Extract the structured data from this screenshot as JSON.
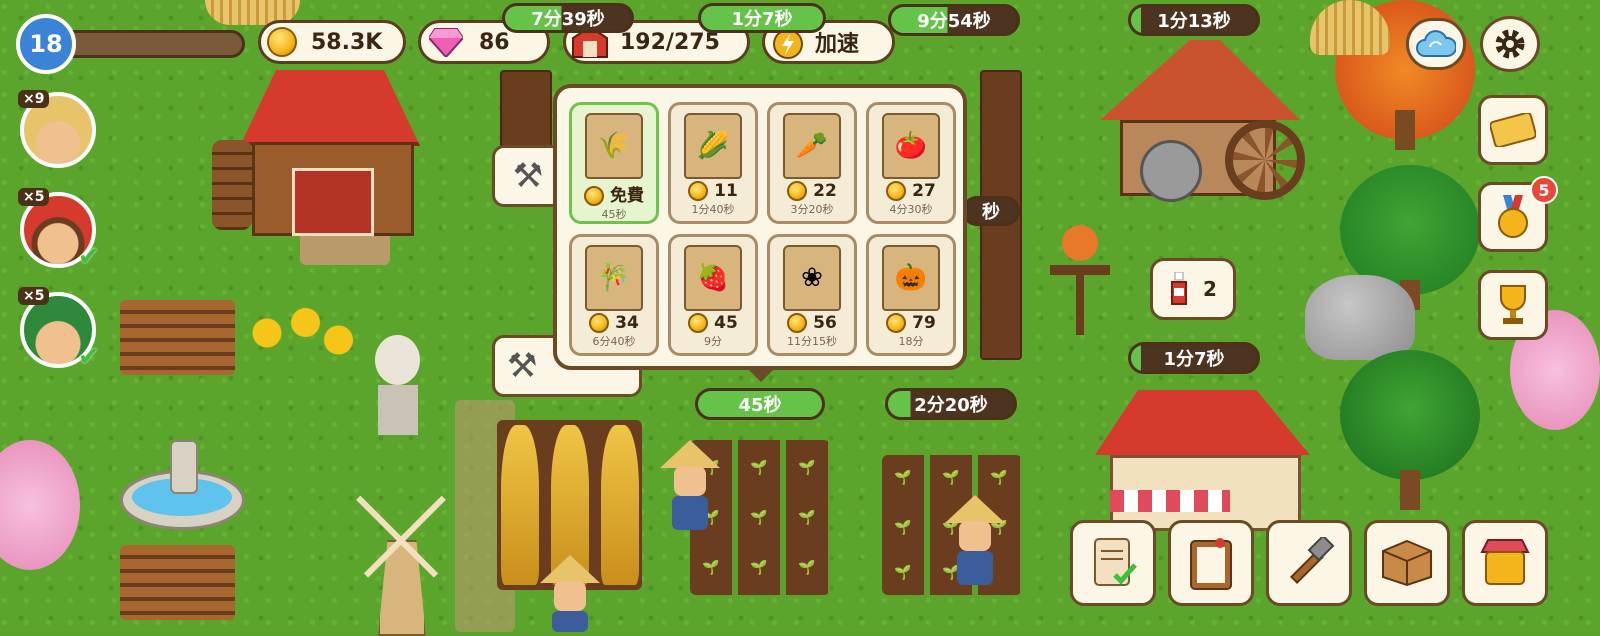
{
  "hud": {
    "level": "18",
    "coins": "58.3K",
    "gems": "86",
    "storage": "192/275",
    "speedup_label": "加速"
  },
  "workers": [
    {
      "count": "×9"
    },
    {
      "count": "×5"
    },
    {
      "count": "×5"
    }
  ],
  "timers": {
    "top_a": "7分39秒",
    "top_b": "1分7秒",
    "top_c": "9分54秒",
    "mill": "1分13秒",
    "seed_plot": "45秒",
    "corn_plot": "2分20秒",
    "bakery": "1分7秒",
    "partial_label": "秒"
  },
  "seed_popup": {
    "items": [
      {
        "crop": "wheat",
        "price": "免費",
        "time": "45秒",
        "selected": true
      },
      {
        "crop": "corn",
        "price": "11",
        "time": "1分40秒"
      },
      {
        "crop": "carrot",
        "price": "22",
        "time": "3分20秒"
      },
      {
        "crop": "tomato",
        "price": "27",
        "time": "4分30秒"
      },
      {
        "crop": "sugarcane",
        "price": "34",
        "time": "6分40秒"
      },
      {
        "crop": "strawberry",
        "price": "45",
        "time": "9分"
      },
      {
        "crop": "cotton",
        "price": "56",
        "time": "11分15秒"
      },
      {
        "crop": "pumpkin",
        "price": "79",
        "time": "18分"
      }
    ]
  },
  "ketchup_bubble": {
    "count": "2"
  },
  "medal_badge": "5",
  "colors": {
    "grass": "#5ca52d",
    "panel": "#fbf6e6",
    "panel_border": "#6b4a26",
    "level_blue": "#3b83d6",
    "timer_green": "#66c34a",
    "badge_red": "#e8473a"
  },
  "icons": {
    "level": "level-badge",
    "coins": "gold-coin-icon",
    "gems": "pink-gem-icon",
    "storage": "barn-icon",
    "speedup": "stopwatch-lightning-icon",
    "cloud": "cloud-sync-icon",
    "settings": "gear-icon",
    "ticket": "ticket-icon",
    "medal": "medal-icon",
    "trophy": "trophy-icon",
    "quests": "scroll-quest-icon",
    "orders": "clipboard-icon",
    "build": "hammer-icon",
    "storage_box": "crate-icon",
    "shop": "shop-basket-icon",
    "harvest": "sickle-icon",
    "ketchup": "ketchup-bottle-icon"
  }
}
